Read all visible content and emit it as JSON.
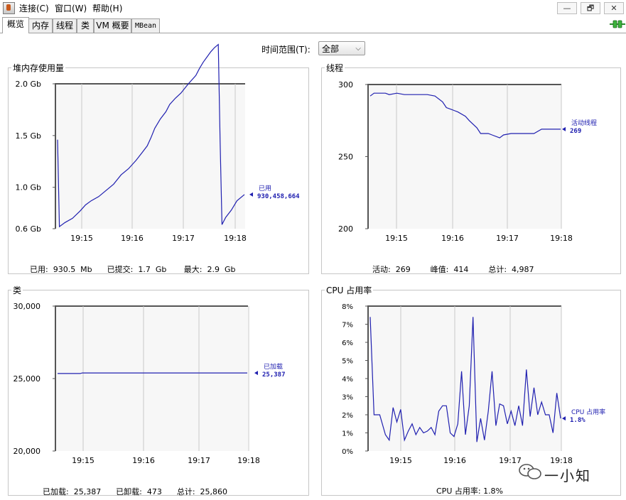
{
  "menu": [
    "连接(C)",
    "窗口(W)",
    "帮助(H)"
  ],
  "window_buttons": [
    "—",
    "🗗",
    "✕"
  ],
  "tabs": [
    "概览",
    "内存",
    "线程",
    "类",
    "VM 概要",
    "MBean"
  ],
  "time_range": {
    "label": "时间范围(T):",
    "value": "全部"
  },
  "panels": {
    "heap": {
      "title": "堆内存使用量",
      "stats": "已用:  930.5  Mb      已提交:  1.7  Gb       最大:  2.9  Gb"
    },
    "threads": {
      "title": "线程",
      "stats": "活动:  269        峰值:  414        总计:  4,987"
    },
    "classes": {
      "title": "类",
      "stats": "已加载:  25,387      已卸载:  473      总计:  25,860"
    },
    "cpu": {
      "title": "CPU 占用率",
      "stats": "CPU 占用率: 1.8%"
    }
  },
  "watermark": "一小知",
  "colors": {
    "series": "#2020b0",
    "grid": "#c8c8c8",
    "plot_bg": "#f7f7f7"
  },
  "chart_data": [
    {
      "id": "heap",
      "type": "line",
      "x_ticks": [
        "19:15",
        "19:16",
        "19:17",
        "19:18"
      ],
      "y_ticks": [
        "0.6 Gb",
        "1.0 Gb",
        "1.5 Gb",
        "2.0 Gb"
      ],
      "y_tick_values": [
        0.6,
        1.0,
        1.5,
        2.0
      ],
      "ylim": [
        0.6,
        2.0
      ],
      "legend": {
        "name": "已用",
        "value": "930,458,664"
      },
      "series": [
        {
          "name": "已用",
          "x": [
            0,
            0.01,
            0.04,
            0.08,
            0.12,
            0.15,
            0.18,
            0.22,
            0.26,
            0.3,
            0.34,
            0.38,
            0.42,
            0.45,
            0.48,
            0.5,
            0.52,
            0.55,
            0.58,
            0.6,
            0.63,
            0.66,
            0.7,
            0.74,
            0.76,
            0.78,
            0.8,
            0.82,
            0.84,
            0.86,
            0.87,
            0.88,
            0.9,
            0.93,
            0.96,
            1.0
          ],
          "y": [
            1.46,
            0.62,
            0.66,
            0.7,
            0.77,
            0.83,
            0.87,
            0.91,
            0.97,
            1.03,
            1.12,
            1.18,
            1.26,
            1.33,
            1.4,
            1.48,
            1.57,
            1.66,
            1.73,
            1.8,
            1.86,
            1.91,
            2.0,
            2.08,
            2.15,
            2.21,
            2.26,
            2.31,
            2.35,
            2.38,
            1.44,
            0.64,
            0.71,
            0.78,
            0.87,
            0.93
          ]
        }
      ]
    },
    {
      "id": "threads",
      "type": "line",
      "x_ticks": [
        "19:15",
        "19:16",
        "19:17",
        "19:18"
      ],
      "y_ticks": [
        "200",
        "250",
        "300"
      ],
      "y_tick_values": [
        200,
        250,
        300
      ],
      "ylim": [
        200,
        300
      ],
      "legend": {
        "name": "活动线程",
        "value": "269"
      },
      "series": [
        {
          "name": "活动线程",
          "x": [
            0,
            0.02,
            0.08,
            0.1,
            0.14,
            0.18,
            0.3,
            0.34,
            0.38,
            0.4,
            0.44,
            0.46,
            0.5,
            0.52,
            0.56,
            0.58,
            0.6,
            0.62,
            0.64,
            0.68,
            0.7,
            0.74,
            0.76,
            0.8,
            0.86,
            0.9,
            0.94,
            1.0
          ],
          "y": [
            292,
            294,
            294,
            293,
            294,
            293,
            293,
            292,
            288,
            284,
            282,
            281,
            278,
            275,
            270,
            266,
            266,
            266,
            265,
            263,
            265,
            266,
            266,
            266,
            266,
            269,
            269,
            269
          ]
        }
      ]
    },
    {
      "id": "classes",
      "type": "line",
      "x_ticks": [
        "19:15",
        "19:16",
        "19:17",
        "19:18"
      ],
      "y_ticks": [
        "20,000",
        "25,000",
        "30,000"
      ],
      "y_tick_values": [
        20000,
        25000,
        30000
      ],
      "ylim": [
        20000,
        30000
      ],
      "legend": {
        "name": "已加载",
        "value": "25,387"
      },
      "series": [
        {
          "name": "已加载",
          "x": [
            0,
            0.12,
            0.13,
            1.0
          ],
          "y": [
            25350,
            25350,
            25387,
            25387
          ]
        }
      ]
    },
    {
      "id": "cpu",
      "type": "line",
      "x_ticks": [
        "19:15",
        "19:16",
        "19:17",
        "19:18"
      ],
      "y_ticks": [
        "0%",
        "1%",
        "2%",
        "3%",
        "4%",
        "5%",
        "6%",
        "7%",
        "8%"
      ],
      "y_tick_values": [
        0,
        1,
        2,
        3,
        4,
        5,
        6,
        7,
        8
      ],
      "ylim": [
        0,
        8
      ],
      "legend": {
        "name": "CPU 占用率",
        "value": "1.8%"
      },
      "series": [
        {
          "name": "CPU 占用率",
          "x": [
            0,
            0.02,
            0.05,
            0.08,
            0.1,
            0.12,
            0.14,
            0.16,
            0.18,
            0.2,
            0.22,
            0.24,
            0.26,
            0.28,
            0.3,
            0.32,
            0.34,
            0.36,
            0.38,
            0.4,
            0.42,
            0.44,
            0.46,
            0.48,
            0.5,
            0.52,
            0.54,
            0.56,
            0.58,
            0.6,
            0.62,
            0.64,
            0.66,
            0.68,
            0.7,
            0.72,
            0.74,
            0.76,
            0.78,
            0.8,
            0.82,
            0.84,
            0.86,
            0.88,
            0.9,
            0.92,
            0.94,
            0.96,
            0.98,
            1.0
          ],
          "y": [
            7.4,
            2.0,
            2.0,
            0.9,
            0.6,
            2.4,
            1.6,
            2.3,
            0.6,
            1.1,
            1.5,
            0.9,
            1.3,
            1.0,
            1.1,
            1.3,
            0.9,
            2.2,
            2.5,
            2.5,
            1.0,
            0.8,
            1.5,
            4.4,
            0.9,
            2.5,
            7.4,
            0.5,
            1.8,
            0.6,
            2.2,
            4.4,
            1.4,
            2.6,
            2.5,
            1.5,
            2.2,
            1.4,
            2.5,
            1.4,
            4.5,
            1.9,
            3.5,
            2.0,
            2.7,
            2.0,
            2.0,
            1.0,
            3.2,
            1.8
          ]
        }
      ]
    }
  ]
}
